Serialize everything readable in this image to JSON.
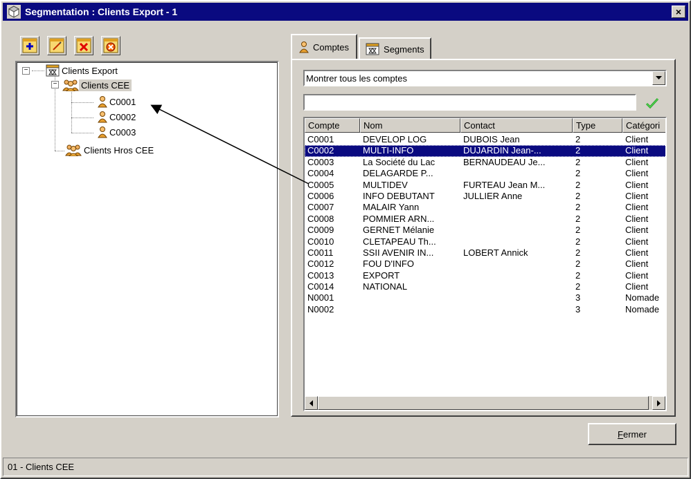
{
  "window": {
    "title": "Segmentation : Clients Export - 1",
    "close_label": "×"
  },
  "toolbar": {
    "buttons": [
      "add-icon",
      "edit-icon",
      "delete-icon",
      "remove-all-icon"
    ]
  },
  "tree": {
    "root": "Clients Export",
    "groups": [
      {
        "label": "Clients CEE",
        "children": [
          "C0001",
          "C0002",
          "C0003"
        ]
      },
      {
        "label": "Clients Hros CEE",
        "children": []
      }
    ]
  },
  "tabs": [
    {
      "label": "Comptes",
      "icon": "person-icon",
      "active": true
    },
    {
      "label": "Segments",
      "icon": "segment-icon",
      "active": false
    }
  ],
  "filter": {
    "combo_value": "Montrer tous les comptes",
    "search_value": ""
  },
  "list": {
    "columns": [
      "Compte",
      "Nom",
      "Contact",
      "Type",
      "Catégori"
    ],
    "rows": [
      [
        "C0001",
        "DEVELOP LOG",
        "DUBOIS Jean",
        "2",
        "Client"
      ],
      [
        "C0002",
        "MULTI-INFO",
        "DUJARDIN Jean-...",
        "2",
        "Client"
      ],
      [
        "C0003",
        "La Société du Lac",
        "BERNAUDEAU Je...",
        "2",
        "Client"
      ],
      [
        "C0004",
        "DELAGARDE P...",
        "",
        "2",
        "Client"
      ],
      [
        "C0005",
        "MULTIDEV",
        "FURTEAU Jean M...",
        "2",
        "Client"
      ],
      [
        "C0006",
        "INFO DEBUTANT",
        "JULLIER Anne",
        "2",
        "Client"
      ],
      [
        "C0007",
        "MALAIR Yann",
        "",
        "2",
        "Client"
      ],
      [
        "C0008",
        "POMMIER ARN...",
        "",
        "2",
        "Client"
      ],
      [
        "C0009",
        "GERNET Mélanie",
        "",
        "2",
        "Client"
      ],
      [
        "C0010",
        "CLETAPEAU Th...",
        "",
        "2",
        "Client"
      ],
      [
        "C0011",
        "SSII AVENIR IN...",
        "LOBERT Annick",
        "2",
        "Client"
      ],
      [
        "C0012",
        "FOU D'INFO",
        "",
        "2",
        "Client"
      ],
      [
        "C0013",
        "EXPORT",
        "",
        "2",
        "Client"
      ],
      [
        "C0014",
        "NATIONAL",
        "",
        "2",
        "Client"
      ],
      [
        "N0001",
        "",
        "",
        "3",
        "Nomade"
      ],
      [
        "N0002",
        "",
        "",
        "3",
        "Nomade"
      ]
    ],
    "selected_row": 1
  },
  "footer": {
    "close_button": "Fermer",
    "status": "01 - Clients CEE"
  },
  "colors": {
    "face": "#d4d0c8",
    "titlebar": "#0a0a80",
    "selection": "#0a0a80"
  }
}
